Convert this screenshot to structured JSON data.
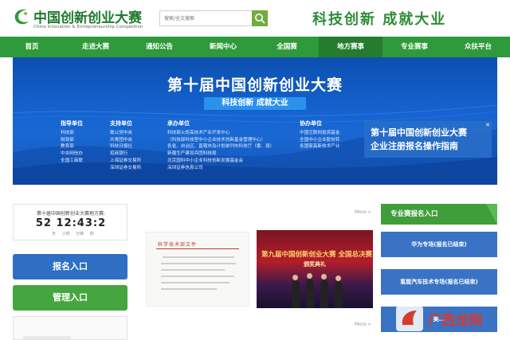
{
  "header": {
    "logo_title": "中国创新创业大赛",
    "logo_subtitle": "China Innovation & Entrepreneurship Competition",
    "search_placeholder": "搜索/全文搜索",
    "slogan": "科技创新 成就大业"
  },
  "nav": {
    "items": [
      "首页",
      "走进大赛",
      "通知公告",
      "新闻中心",
      "全国赛",
      "地方赛事",
      "专业赛事",
      "众扶平台"
    ],
    "active_index": 5
  },
  "banner": {
    "title": "第十届中国创新创业大赛",
    "slogan": "科技创新 成就大业",
    "columns": [
      {
        "head": "指导单位",
        "lines": [
          "科技部",
          "财政部",
          "教育部",
          "中央网信办",
          "全国工商联"
        ]
      },
      {
        "head": "支持单位",
        "lines": [
          "致公党中央",
          "共青团中央",
          "科技日报社",
          "招商银行",
          "上海证券交易所",
          "深圳证券交易所"
        ]
      },
      {
        "head": "承办单位",
        "lines": [
          "科技部火炬高技术产业开发中心",
          "（科技部科技型中小企业技术创新基金管理中心）",
          "各省、自治区、直辖市及计划单列市科技厅（委、局）",
          "新疆生产建设兵团科技局",
          "北京国科中小企业科技创新发展基金会",
          "深圳证券信息公司"
        ]
      },
      {
        "head": "协办单位",
        "lines": [
          "中国互联网投资基金",
          "全国中小企业股份转",
          "各国家高新技术产业"
        ]
      }
    ],
    "overlay": {
      "line1": "第十届中国创新创业大赛",
      "line2": "企业注册报名操作指南",
      "close_icon": "x-icon"
    }
  },
  "countdown": {
    "label": "第十届中国创新创业大赛地方赛:",
    "value": "52 12:43:2",
    "units": "天 小时 分钟 秒"
  },
  "left_buttons": {
    "signup": "报名入口",
    "manage": "管理入口"
  },
  "news": {
    "more_label": "More »",
    "doc_head": "科学技术部文件",
    "photo_title": "第九届中国创新创业大赛 全国总决赛",
    "photo_sub": "颁奖典礼"
  },
  "right": {
    "header": "专业赛报名入口",
    "items": [
      "华为专场(报名已结束)",
      "氢能汽车技术专场(报名已结束)",
      "美..."
    ],
    "watermark": "广西龙网"
  },
  "colors": {
    "brand_green": "#2e9a3a",
    "brand_blue": "#2e6fc4",
    "banner_blue": "#1564d1"
  }
}
